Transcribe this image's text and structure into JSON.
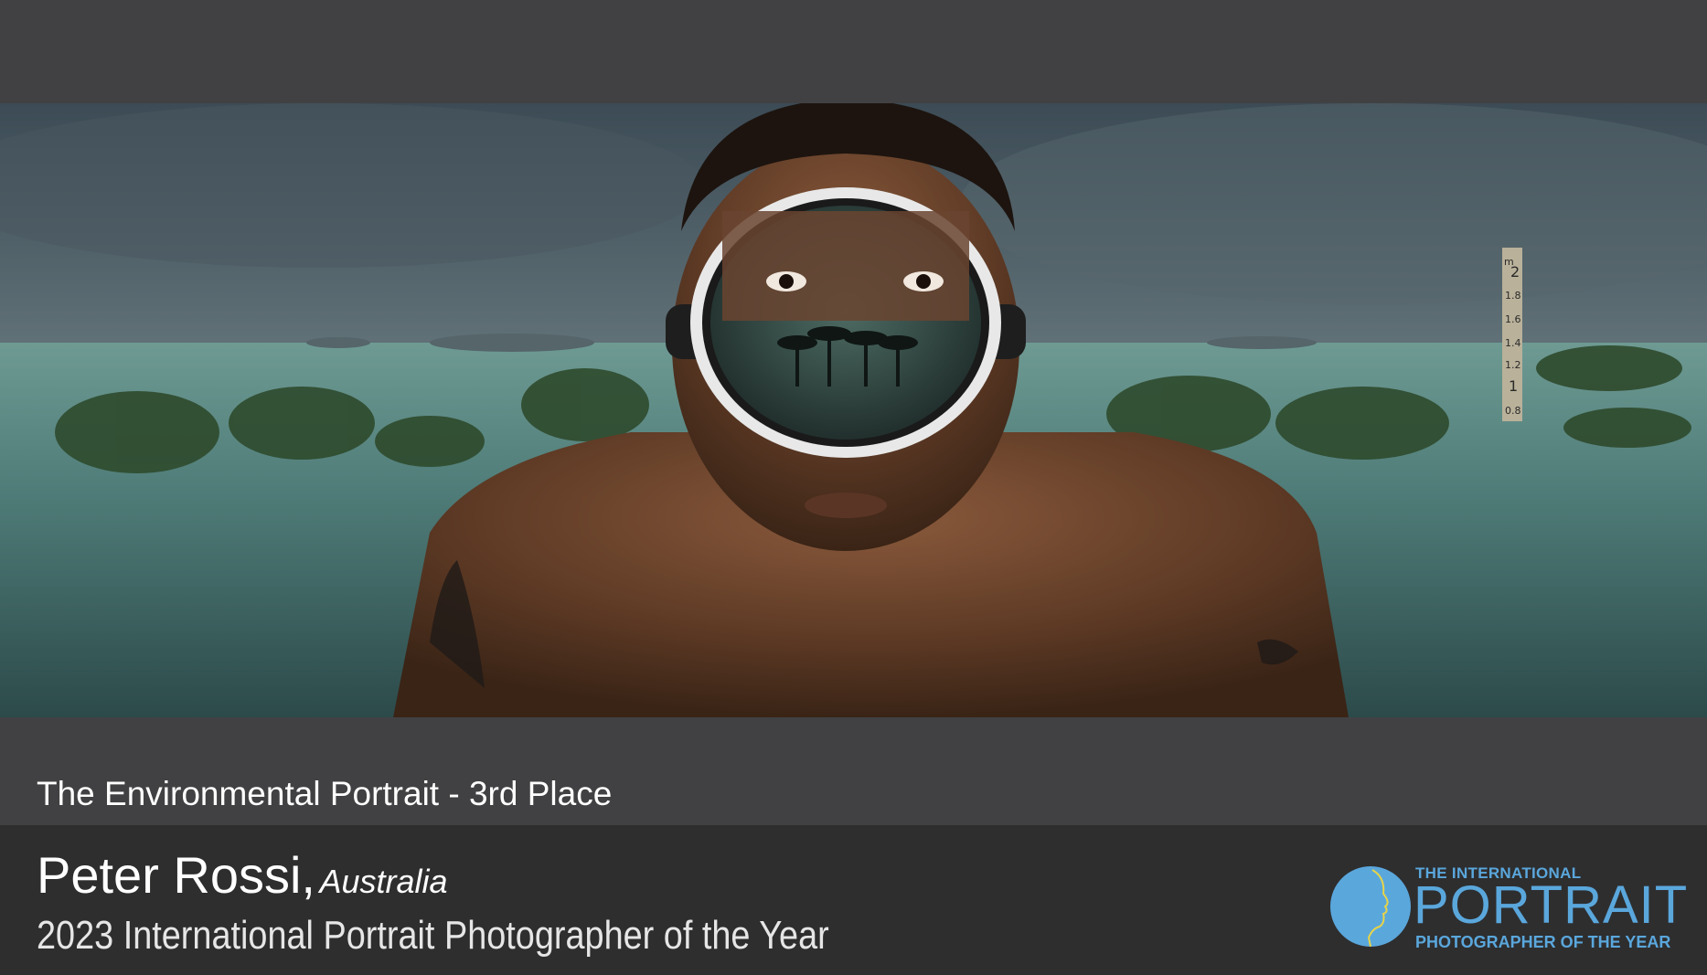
{
  "category": "The Environmental Portrait - 3rd Place",
  "photographer": {
    "name": "Peter Rossi,",
    "country": "Australia"
  },
  "award": "2023 International Portrait Photographer of the Year",
  "logo": {
    "line1": "THE INTERNATIONAL",
    "line2": "PORTRAIT",
    "line3": "PHOTOGRAPHER OF THE YEAR"
  },
  "gauge": {
    "unit": "m",
    "marks": [
      "2",
      "1.8",
      "1.6",
      "1.4",
      "1.2",
      "1",
      "0.8"
    ]
  },
  "colors": {
    "background": "#414143",
    "footer": "#2e2e2f",
    "logo_blue": "#5aa7dc"
  }
}
